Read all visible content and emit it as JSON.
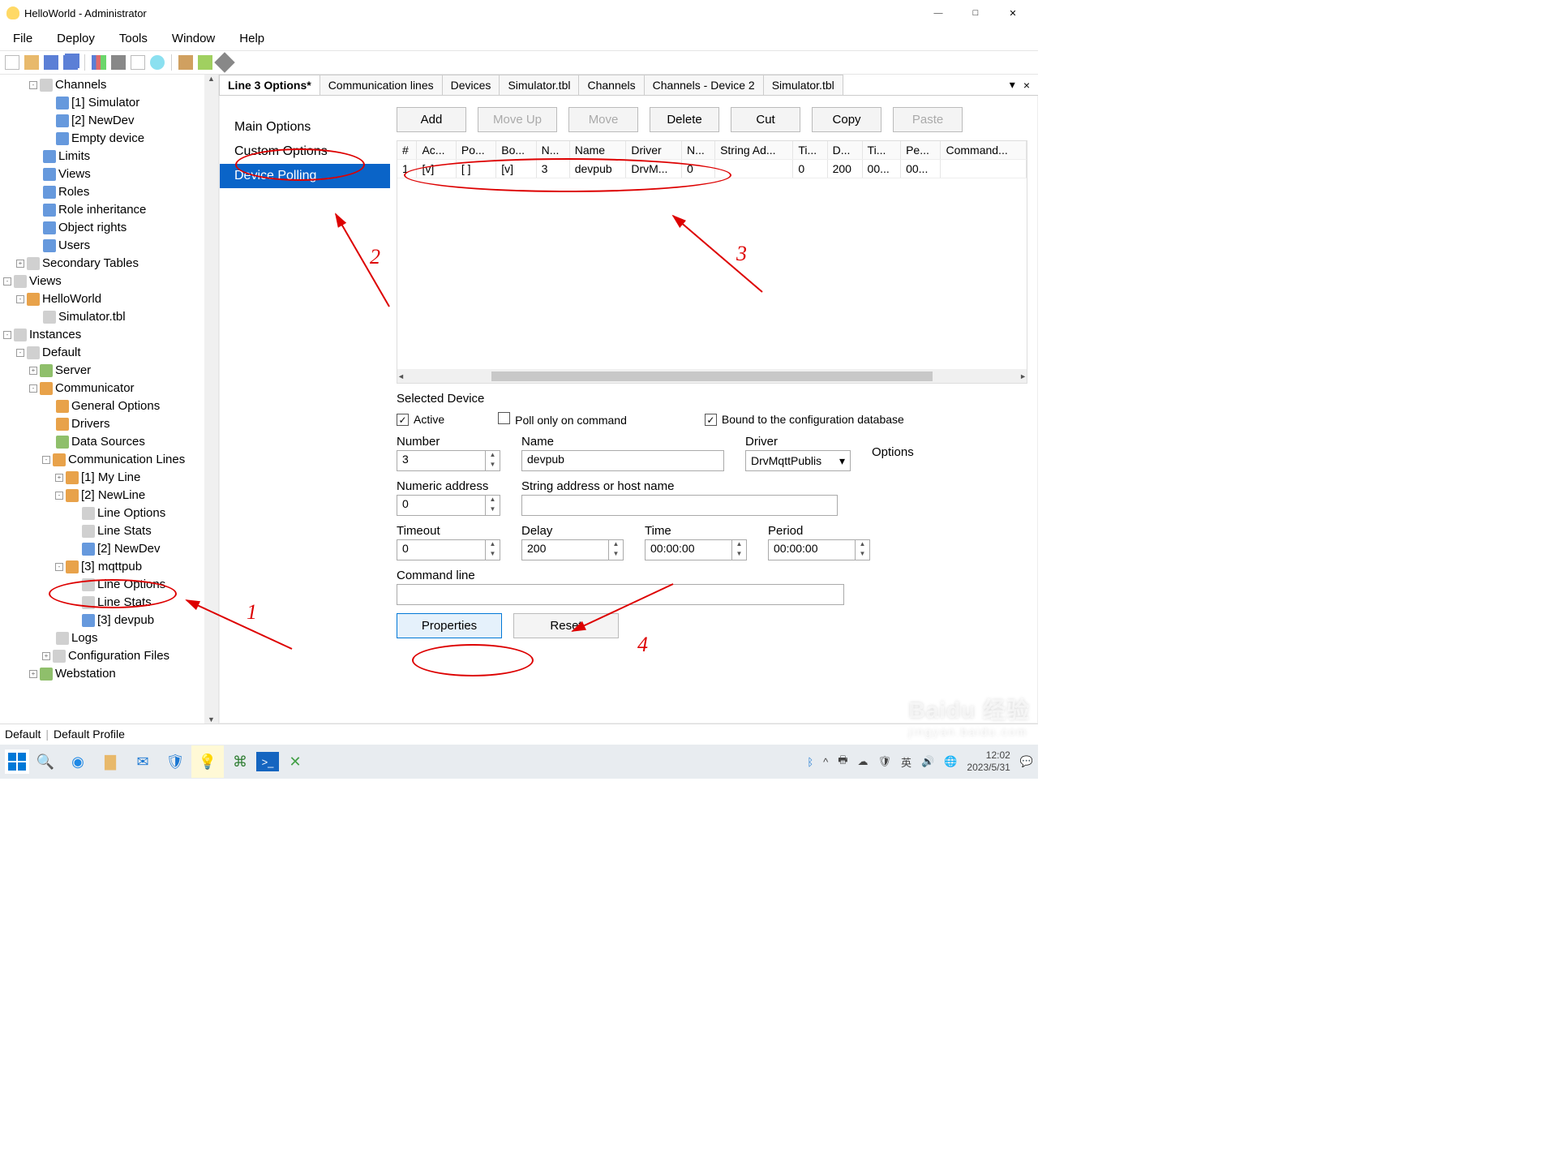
{
  "window": {
    "title": "HelloWorld - Administrator"
  },
  "menu": {
    "file": "File",
    "deploy": "Deploy",
    "tools": "Tools",
    "window": "Window",
    "help": "Help"
  },
  "tree": {
    "items": [
      {
        "d": 1,
        "exp": "-",
        "ico": "pg",
        "t": "Channels"
      },
      {
        "d": 2,
        "exp": "",
        "ico": "fb",
        "t": "[1] Simulator"
      },
      {
        "d": 2,
        "exp": "",
        "ico": "fb",
        "t": "[2] NewDev"
      },
      {
        "d": 2,
        "exp": "",
        "ico": "fb",
        "t": "Empty device"
      },
      {
        "d": 1,
        "exp": "",
        "ico": "fb",
        "t": "Limits"
      },
      {
        "d": 1,
        "exp": "",
        "ico": "fb",
        "t": "Views"
      },
      {
        "d": 1,
        "exp": "",
        "ico": "fb",
        "t": "Roles"
      },
      {
        "d": 1,
        "exp": "",
        "ico": "fb",
        "t": "Role inheritance"
      },
      {
        "d": 1,
        "exp": "",
        "ico": "fb",
        "t": "Object rights"
      },
      {
        "d": 1,
        "exp": "",
        "ico": "fb",
        "t": "Users"
      },
      {
        "d": 0,
        "exp": "+",
        "ico": "pg",
        "t": "Secondary Tables"
      },
      {
        "d": -1,
        "exp": "-",
        "ico": "pg",
        "t": "Views"
      },
      {
        "d": 0,
        "exp": "-",
        "ico": "or",
        "t": "HelloWorld"
      },
      {
        "d": 1,
        "exp": "",
        "ico": "pg",
        "t": "Simulator.tbl"
      },
      {
        "d": -1,
        "exp": "-",
        "ico": "pg",
        "t": "Instances"
      },
      {
        "d": 0,
        "exp": "-",
        "ico": "pg",
        "t": "Default"
      },
      {
        "d": 1,
        "exp": "+",
        "ico": "gr",
        "t": "Server"
      },
      {
        "d": 1,
        "exp": "-",
        "ico": "or",
        "t": "Communicator"
      },
      {
        "d": 2,
        "exp": "",
        "ico": "or",
        "t": "General Options"
      },
      {
        "d": 2,
        "exp": "",
        "ico": "or",
        "t": "Drivers"
      },
      {
        "d": 2,
        "exp": "",
        "ico": "gr",
        "t": "Data Sources"
      },
      {
        "d": 2,
        "exp": "-",
        "ico": "or",
        "t": "Communication Lines"
      },
      {
        "d": 3,
        "exp": "+",
        "ico": "or",
        "t": "[1] My Line"
      },
      {
        "d": 3,
        "exp": "-",
        "ico": "or",
        "t": "[2] NewLine"
      },
      {
        "d": 4,
        "exp": "",
        "ico": "pg",
        "t": "Line Options"
      },
      {
        "d": 4,
        "exp": "",
        "ico": "pg",
        "t": "Line Stats"
      },
      {
        "d": 4,
        "exp": "",
        "ico": "fb",
        "t": "[2] NewDev"
      },
      {
        "d": 3,
        "exp": "-",
        "ico": "or",
        "t": "[3] mqttpub"
      },
      {
        "d": 4,
        "exp": "",
        "ico": "pg",
        "t": "Line Options"
      },
      {
        "d": 4,
        "exp": "",
        "ico": "pg",
        "t": "Line Stats"
      },
      {
        "d": 4,
        "exp": "",
        "ico": "fb",
        "t": "[3] devpub"
      },
      {
        "d": 2,
        "exp": "",
        "ico": "pg",
        "t": "Logs"
      },
      {
        "d": 2,
        "exp": "+",
        "ico": "pg",
        "t": "Configuration Files"
      },
      {
        "d": 1,
        "exp": "+",
        "ico": "gr",
        "t": "Webstation"
      }
    ]
  },
  "tabs": [
    "Line 3 Options*",
    "Communication lines",
    "Devices",
    "Simulator.tbl",
    "Channels",
    "Channels - Device 2",
    "Simulator.tbl"
  ],
  "sideitems": [
    "Main Options",
    "Custom Options",
    "Device Polling"
  ],
  "toolbarBtns": {
    "add": "Add",
    "moveup": "Move Up",
    "move": "Move",
    "delete": "Delete",
    "cut": "Cut",
    "copy": "Copy",
    "paste": "Paste"
  },
  "gridCols": [
    "#",
    "Ac...",
    "Po...",
    "Bo...",
    "N...",
    "Name",
    "Driver",
    "N...",
    "String Ad...",
    "Ti...",
    "D...",
    "Ti...",
    "Pe...",
    "Command..."
  ],
  "gridRow": [
    "1",
    "[v]",
    "[ ]",
    "[v]",
    "3",
    "devpub",
    "DrvM...",
    "0",
    "",
    "0",
    "200",
    "00...",
    "00...",
    ""
  ],
  "selDev": {
    "title": "Selected Device",
    "active": "Active",
    "poll": "Poll only on command",
    "bound": "Bound to the configuration database",
    "lbl_number": "Number",
    "lbl_name": "Name",
    "lbl_driver": "Driver",
    "lbl_options": "Options",
    "val_number": "3",
    "val_name": "devpub",
    "val_driver": "DrvMqttPublis",
    "lbl_numaddr": "Numeric address",
    "lbl_straddr": "String address or host name",
    "val_numaddr": "0",
    "val_straddr": "",
    "lbl_timeout": "Timeout",
    "lbl_delay": "Delay",
    "lbl_time": "Time",
    "lbl_period": "Period",
    "val_timeout": "0",
    "val_delay": "200",
    "val_time": "00:00:00",
    "val_period": "00:00:00",
    "lbl_cmd": "Command line",
    "val_cmd": "",
    "properties": "Properties",
    "reset": "Reset"
  },
  "status": {
    "a": "Default",
    "b": "Default Profile"
  },
  "tray": {
    "ime": "英",
    "time": "12:02",
    "date": "2023/5/31"
  },
  "anno": {
    "1": "1",
    "2": "2",
    "3": "3",
    "4": "4"
  },
  "watermark": {
    "brand": "Baidu 经验",
    "sub": "jingyan.baidu.com"
  }
}
